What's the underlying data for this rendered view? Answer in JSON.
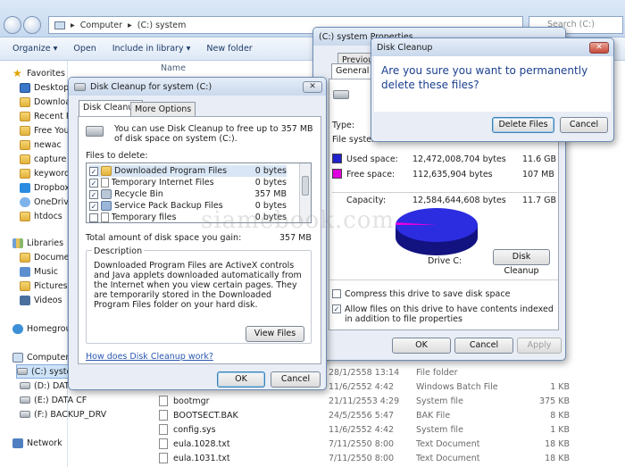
{
  "explorer": {
    "breadcrumb": [
      "Computer",
      "(C:) system"
    ],
    "search_placeholder": "Search (C:) system",
    "toolbar": [
      "Organize ▾",
      "Open",
      "Include in library ▾",
      "New folder"
    ],
    "column_name": "Name",
    "nav": [
      {
        "label": "Favorites",
        "icon": "star-icon",
        "type": "header"
      },
      {
        "label": "Desktop",
        "icon": "desktop-icon"
      },
      {
        "label": "Downloads",
        "icon": "folder-icon"
      },
      {
        "label": "Recent Places",
        "icon": "folder-icon"
      },
      {
        "label": "Free YouTube",
        "icon": "folder-icon"
      },
      {
        "label": "newac",
        "icon": "folder-icon"
      },
      {
        "label": "capture",
        "icon": "folder-icon"
      },
      {
        "label": "keywords",
        "icon": "folder-icon"
      },
      {
        "label": "Dropbox",
        "icon": "dropbox-icon"
      },
      {
        "label": "OneDrive",
        "icon": "cloud-icon"
      },
      {
        "label": "htdocs",
        "icon": "folder-icon"
      },
      {
        "label": "Libraries",
        "icon": "library-icon",
        "type": "header"
      },
      {
        "label": "Documents",
        "icon": "folder-icon"
      },
      {
        "label": "Music",
        "icon": "music-icon"
      },
      {
        "label": "Pictures",
        "icon": "folder-icon"
      },
      {
        "label": "Videos",
        "icon": "video-icon"
      },
      {
        "label": "Homegroup",
        "icon": "homegroup-icon",
        "type": "header"
      },
      {
        "label": "Computer",
        "icon": "computer-icon",
        "type": "header"
      },
      {
        "label": "(C:) system",
        "icon": "drive-icon",
        "selected": true
      },
      {
        "label": "(D:) DATA",
        "icon": "drive-icon"
      },
      {
        "label": "(E:) DATA CF",
        "icon": "drive-icon"
      },
      {
        "label": "(F:) BACKUP_DRV",
        "icon": "drive-icon"
      },
      {
        "label": "Network",
        "icon": "network-icon",
        "type": "header"
      }
    ],
    "files": [
      {
        "name": "",
        "date": "28/1/2558 13:14",
        "type": "File folder",
        "size": ""
      },
      {
        "name": "",
        "date": "11/6/2552 4:42",
        "type": "Windows Batch File",
        "size": "1 KB"
      },
      {
        "name": "bootmgr",
        "date": "21/11/2553 4:29",
        "type": "System file",
        "size": "375 KB"
      },
      {
        "name": "BOOTSECT.BAK",
        "date": "24/5/2556 5:47",
        "type": "BAK File",
        "size": "8 KB"
      },
      {
        "name": "config.sys",
        "date": "11/6/2552 4:42",
        "type": "System file",
        "size": "1 KB"
      },
      {
        "name": "eula.1028.txt",
        "date": "7/11/2550 8:00",
        "type": "Text Document",
        "size": "18 KB"
      },
      {
        "name": "eula.1031.txt",
        "date": "7/11/2550 8:00",
        "type": "Text Document",
        "size": "18 KB"
      }
    ]
  },
  "disk_cleanup": {
    "title": "Disk Cleanup for system (C:)",
    "tabs": [
      "Disk Cleanup",
      "More Options"
    ],
    "intro": "You can use Disk Cleanup to free up to 357 MB of disk space on system (C:).",
    "files_label": "Files to delete:",
    "items": [
      {
        "name": "Downloaded Program Files",
        "size": "0 bytes",
        "checked": true
      },
      {
        "name": "Temporary Internet Files",
        "size": "0 bytes",
        "checked": true
      },
      {
        "name": "Recycle Bin",
        "size": "357 MB",
        "checked": true
      },
      {
        "name": "Service Pack Backup Files",
        "size": "0 bytes",
        "checked": true
      },
      {
        "name": "Temporary files",
        "size": "0 bytes",
        "checked": false
      }
    ],
    "total_label": "Total amount of disk space you gain:",
    "total_value": "357 MB",
    "description_label": "Description",
    "description": "Downloaded Program Files are ActiveX controls and Java applets downloaded automatically from the Internet when you view certain pages. They are temporarily stored in the Downloaded Program Files folder on your hard disk.",
    "view_files": "View Files",
    "help_link": "How does Disk Cleanup work?",
    "ok": "OK",
    "cancel": "Cancel"
  },
  "properties": {
    "title": "(C:) system Properties",
    "tabs": [
      "Previous Versions",
      "General"
    ],
    "type_label": "Type:",
    "fs_label": "File system:",
    "used_label": "Used space:",
    "used_bytes": "12,472,008,704 bytes",
    "used_gb": "11.6 GB",
    "free_label": "Free space:",
    "free_bytes": "112,635,904 bytes",
    "free_gb": "107 MB",
    "capacity_label": "Capacity:",
    "capacity_bytes": "12,584,644,608 bytes",
    "capacity_gb": "11.7 GB",
    "drive_label": "Drive C:",
    "disk_cleanup_btn": "Disk Cleanup",
    "compress": "Compress this drive to save disk space",
    "index": "Allow files on this drive to have contents indexed in addition to file properties",
    "ok": "OK",
    "cancel": "Cancel",
    "apply": "Apply",
    "used_color": "#2222cc",
    "free_color": "#e000e0"
  },
  "confirm": {
    "title": "Disk Cleanup",
    "message": "Are you sure you want to permanently delete these files?",
    "delete": "Delete Files",
    "cancel": "Cancel"
  },
  "watermark": "siamebook.com"
}
